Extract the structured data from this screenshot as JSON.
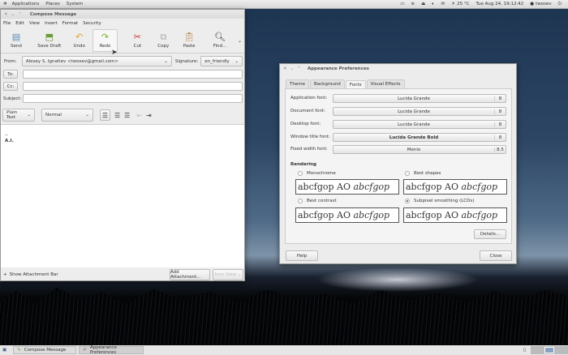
{
  "top_panel": {
    "menus": [
      "Applications",
      "Places",
      "System"
    ],
    "temperature": "25 °C",
    "clock": "Tue Aug 24, 19:12:42",
    "user": "twosev"
  },
  "compose": {
    "title": "Compose Message",
    "menu": [
      "File",
      "Edit",
      "View",
      "Insert",
      "Format",
      "Security"
    ],
    "toolbar": [
      "Send",
      "Save Draft",
      "Undo",
      "Redo",
      "Cut",
      "Copy",
      "Paste",
      "Find..."
    ],
    "from_label": "From:",
    "from_value": "Alexey S. Ignatiev <twosev@gmail.com>",
    "signature_label": "Signature:",
    "signature_value": "en_friendly",
    "to_label": "To:",
    "cc_label": "Cc:",
    "subject_label": "Subject:",
    "format_mode": "Plain Text",
    "paragraph_style": "Normal",
    "body_lines": [
      "--",
      "A.I."
    ],
    "show_attachment_bar": "Show Attachment Bar",
    "add_attachment": "Add Attachment...",
    "icon_view": "Icon View"
  },
  "appearance": {
    "title": "Appearance Preferences",
    "tabs": [
      "Theme",
      "Background",
      "Fonts",
      "Visual Effects"
    ],
    "active_tab": "Fonts",
    "fonts": [
      {
        "label": "Application font:",
        "name": "Lucida Grande",
        "size": "8"
      },
      {
        "label": "Document font:",
        "name": "Lucida Grande",
        "size": "8"
      },
      {
        "label": "Desktop font:",
        "name": "Lucida Grande",
        "size": "8"
      },
      {
        "label": "Window title font:",
        "name": "Lucida Grande Bold",
        "size": "8"
      },
      {
        "label": "Fixed width font:",
        "name": "Menlo",
        "size": "8.5"
      }
    ],
    "rendering_label": "Rendering",
    "options": [
      {
        "label": "Monochrome",
        "selected": false
      },
      {
        "label": "Best shapes",
        "selected": false
      },
      {
        "label": "Best contrast",
        "selected": false
      },
      {
        "label": "Subpixel smoothing (LCDs)",
        "selected": true
      }
    ],
    "sample_regular": "abcfgop AO ",
    "sample_italic": "abcfgop",
    "details": "Details...",
    "help": "Help",
    "close": "Close"
  },
  "taskbar": {
    "items": [
      "Compose Message",
      "Appearance Preferences"
    ]
  }
}
